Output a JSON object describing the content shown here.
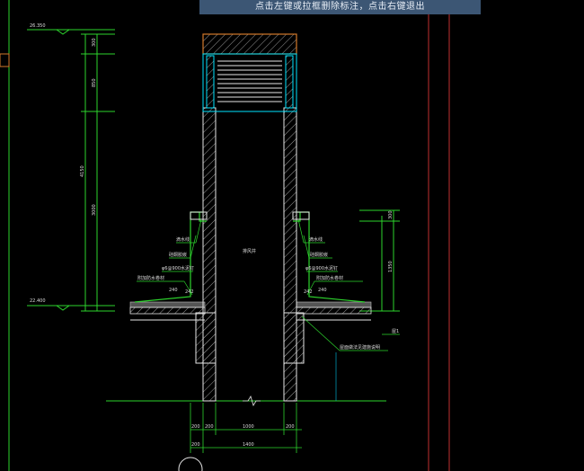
{
  "status_hint": "点击左键或拉框删除标注，点击右键退出",
  "drawing": {
    "elevations": {
      "top": "26.350",
      "bottom": "22.400"
    },
    "left_dims": [
      "300",
      "850",
      "4150",
      "3000"
    ],
    "right_dims": [
      "300",
      "1350"
    ],
    "bottom_dims_row1": [
      "200",
      "200",
      "1000",
      "200"
    ],
    "bottom_dims_row2": [
      "200",
      "1400"
    ],
    "shaft_label": "排风井",
    "left_notes": [
      "滴水线",
      "硅酮胶嵌",
      "φ6@900水泥钉",
      "附加防水卷材",
      "240",
      "242"
    ],
    "right_notes": [
      "滴水线",
      "硅酮胶嵌",
      "φ6@900水泥钉",
      "附加防水卷材",
      "242",
      "240"
    ],
    "right_callouts": [
      "屋面做法见建施说明",
      "屋1"
    ]
  },
  "colors": {
    "background": "#000000",
    "dim_green": "#2dd42d",
    "wall_white": "#e6e6e6",
    "cyan": "#00e5ff",
    "orange": "#d2782a",
    "red_line": "#c03030",
    "hint_bar": "#3c5674"
  }
}
